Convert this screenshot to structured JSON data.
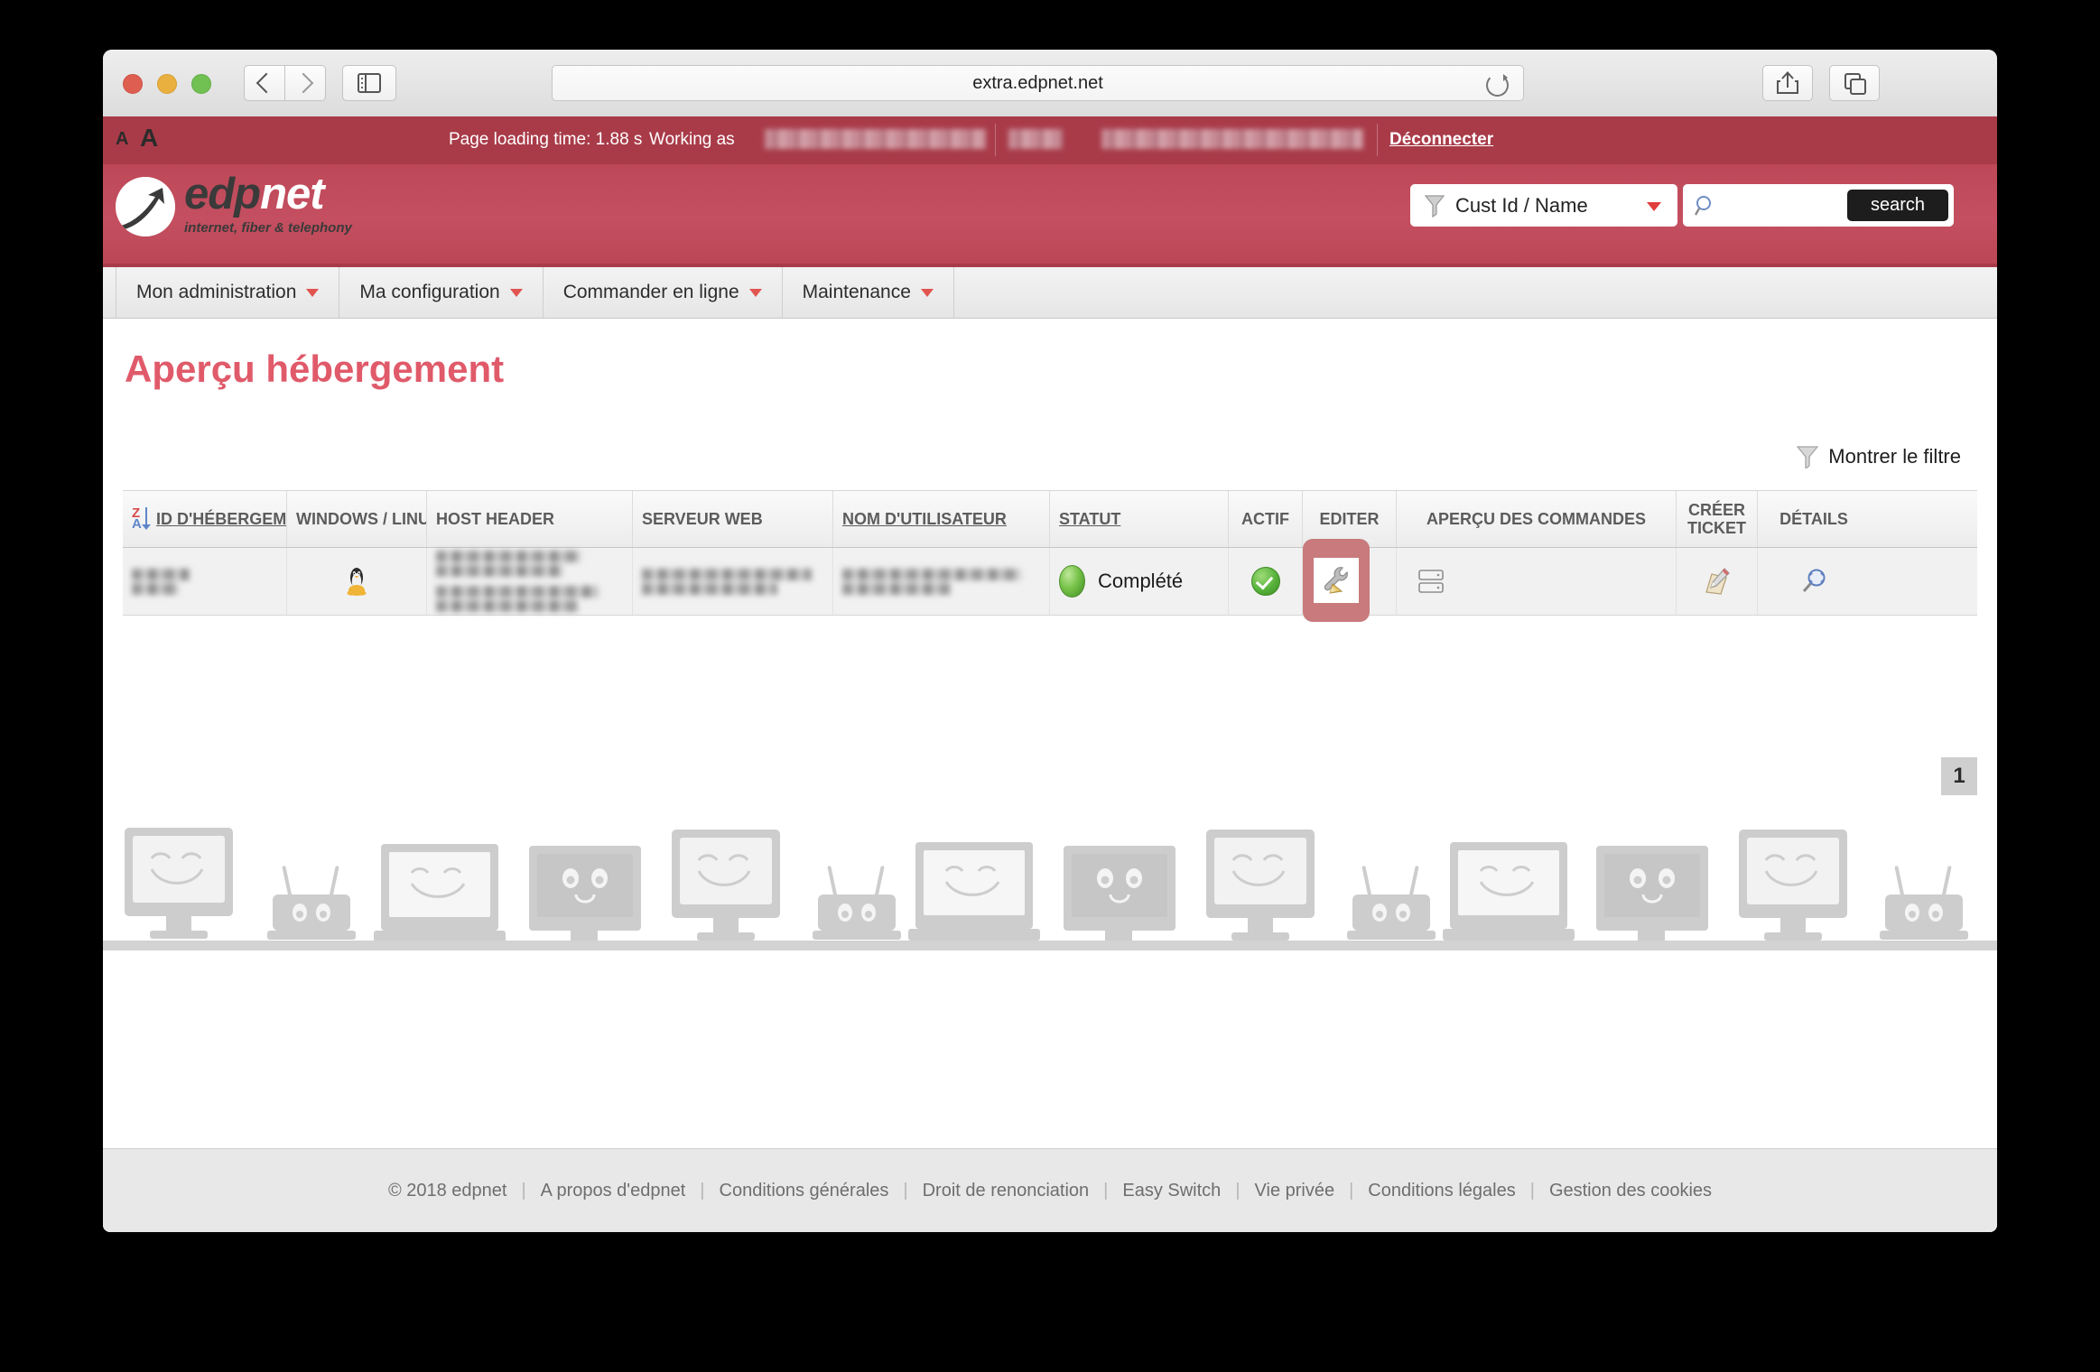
{
  "browser": {
    "url": "extra.edpnet.net",
    "back_icon": "chevron-left-icon",
    "forward_icon": "chevron-right-icon",
    "sidebar_icon": "sidebar-toggle-icon",
    "reload_icon": "reload-icon",
    "share_icon": "share-icon",
    "tabs_icon": "tab-overview-icon",
    "newtab_label": "+"
  },
  "topbar": {
    "font_small": "A",
    "font_large": "A",
    "loading_time": "Page loading time: 1.88 s",
    "working_as": "Working as",
    "logout": "Déconnecter"
  },
  "brand": {
    "word_dark": "edp",
    "word_light": "net",
    "tagline": "internet, fiber & telephony",
    "accent_dark": "#a93b49",
    "accent_light": "#bd4858",
    "title_color": "#e05a6a"
  },
  "search": {
    "filter_icon": "funnel-icon",
    "selected_scope": "Cust Id / Name",
    "caret_icon": "caret-down-icon",
    "magnifier_icon": "magnifier-icon",
    "input_value": "",
    "input_placeholder": "",
    "button_label": "search"
  },
  "nav": {
    "items": [
      {
        "label": "Mon administration"
      },
      {
        "label": "Ma configuration"
      },
      {
        "label": "Commander en ligne"
      },
      {
        "label": "Maintenance"
      }
    ]
  },
  "main": {
    "title": "Aperçu hébergement",
    "filter_toggle": "Montrer le filtre",
    "filter_icon": "funnel-icon",
    "pagination_current": "1"
  },
  "table": {
    "columns": [
      {
        "label": "ID D'HÉBERGEMEN",
        "sortable": true,
        "sort_icon": "sort-za-icon"
      },
      {
        "label": "WINDOWS / LINUX",
        "sortable": false
      },
      {
        "label": "HOST HEADER",
        "sortable": false
      },
      {
        "label": "SERVEUR WEB",
        "sortable": false
      },
      {
        "label": "NOM D'UTILISATEUR",
        "sortable": true
      },
      {
        "label": "STATUT",
        "sortable": true
      },
      {
        "label": "ACTIF",
        "sortable": false
      },
      {
        "label": "EDITER",
        "sortable": false
      },
      {
        "label": "APERÇU DES COMMANDES",
        "sortable": false
      },
      {
        "label": "CRÉER TICKET",
        "sortable": false
      },
      {
        "label": "DÉTAILS",
        "sortable": false
      }
    ],
    "rows": [
      {
        "hosting_id": "",
        "os_icon": "linux-penguin-icon",
        "host_header": "",
        "web_server": "",
        "username": "",
        "status_label": "Complété",
        "status_icon": "green-ellipse-icon",
        "active_icon": "green-check-icon",
        "edit_icon": "wrench-pencil-icon",
        "edit_highlighted": true,
        "orders_icon": "server-list-icon",
        "ticket_icon": "ticket-pencil-icon",
        "details_icon": "magnifier-details-icon"
      }
    ]
  },
  "footer": {
    "links": [
      "© 2018 edpnet",
      "A propos d'edpnet",
      "Conditions générales",
      "Droit de renonciation",
      "Easy Switch",
      "Vie privée",
      "Conditions légales",
      "Gestion des cookies"
    ]
  }
}
